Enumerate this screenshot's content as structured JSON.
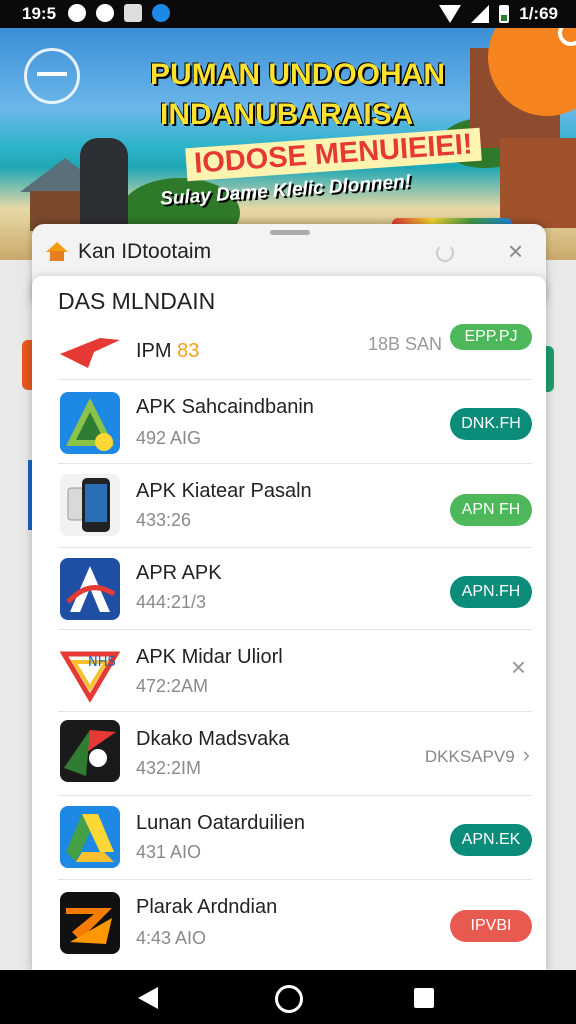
{
  "status_bar": {
    "time": "19:5",
    "right_time": "1/:69"
  },
  "hero": {
    "title_line1": "PUMAN UNDOOHAN",
    "title_line2": "INDANUBARAISA",
    "title_line3": "IODOSE MENUIEIEI!",
    "subtitle": "Sulay Dame Klelic Dlonnen!"
  },
  "dialog": {
    "title": "Kan IDtootaim"
  },
  "sheet": {
    "header": "DAS MLNDAIN",
    "items": [
      {
        "name": "IPM",
        "name_accent": "83",
        "size": "",
        "time": "18B SAN",
        "action": "EPP.PJ",
        "action_color": "#4cb85a",
        "icon_name": "red-arrow-app-icon"
      },
      {
        "name": "APK Sahcaindbanin",
        "size": "492 AIG",
        "action": "DNK.FH",
        "action_color": "#0c8d79",
        "icon_name": "triangle-app-icon"
      },
      {
        "name": "APK Kiatear Pasaln",
        "size": "433:26",
        "action": "APN FH",
        "action_color": "#4cb85a",
        "icon_name": "phone-app-icon"
      },
      {
        "name": "APR APK",
        "size": "444:21/3",
        "action": "APN.FH",
        "action_color": "#0c8d79",
        "icon_name": "blue-a-app-icon"
      },
      {
        "name": "APK Midar Uliorl",
        "size": "472:2AM",
        "action": "×",
        "icon_name": "colorful-a-app-icon"
      },
      {
        "name": "Dkako Madsvaka",
        "size": "432:2IM",
        "action": "DKKSAPV9",
        "icon_name": "red-green-app-icon"
      },
      {
        "name": "Lunan Oatarduilien",
        "size": "431 AIO",
        "action": "APN.EK",
        "action_color": "#0c8d79",
        "icon_name": "drive-style-app-icon"
      },
      {
        "name": "Plarak Ardndian",
        "size": "4:43 AIO",
        "action": "IPVBI",
        "action_color": "#e85a4f",
        "icon_name": "orange-arrow-app-icon"
      }
    ]
  }
}
